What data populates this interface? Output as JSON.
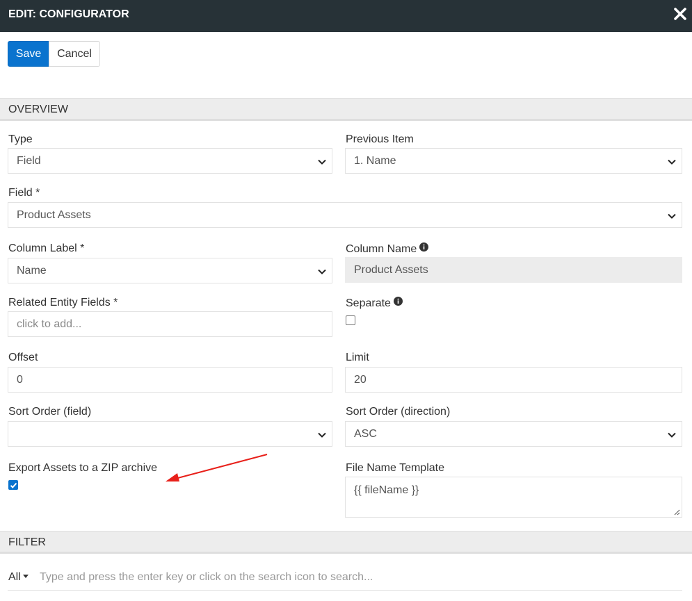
{
  "header": {
    "title": "EDIT: CONFIGURATOR",
    "close_icon": "close-icon"
  },
  "toolbar": {
    "save_label": "Save",
    "cancel_label": "Cancel"
  },
  "sections": {
    "overview": "OVERVIEW",
    "filter": "FILTER"
  },
  "fields": {
    "type": {
      "label": "Type",
      "value": "Field"
    },
    "previous_item": {
      "label": "Previous Item",
      "value": "1. Name"
    },
    "field": {
      "label": "Field *",
      "value": "Product Assets"
    },
    "column_label": {
      "label": "Column Label *",
      "value": "Name"
    },
    "column_name": {
      "label": "Column Name",
      "value": "Product Assets",
      "info_icon": "info-icon"
    },
    "related_entity_fields": {
      "label": "Related Entity Fields *",
      "placeholder": "click to add..."
    },
    "separate": {
      "label": "Separate",
      "checked": false,
      "info_icon": "info-icon"
    },
    "offset": {
      "label": "Offset",
      "value": "0"
    },
    "limit": {
      "label": "Limit",
      "value": "20"
    },
    "sort_order_field": {
      "label": "Sort Order (field)",
      "value": ""
    },
    "sort_order_direction": {
      "label": "Sort Order (direction)",
      "value": "ASC"
    },
    "export_zip": {
      "label": "Export Assets to a ZIP archive",
      "checked": true
    },
    "file_name_template": {
      "label": "File Name Template",
      "value": "{{ fileName }}"
    }
  },
  "filter": {
    "scope": "All",
    "search_placeholder": "Type and press the enter key or click on the search icon to search..."
  },
  "colors": {
    "header_bg": "#273237",
    "primary": "#0a73ce",
    "annotation_arrow": "#e8201a",
    "section_bg": "#ededed"
  }
}
